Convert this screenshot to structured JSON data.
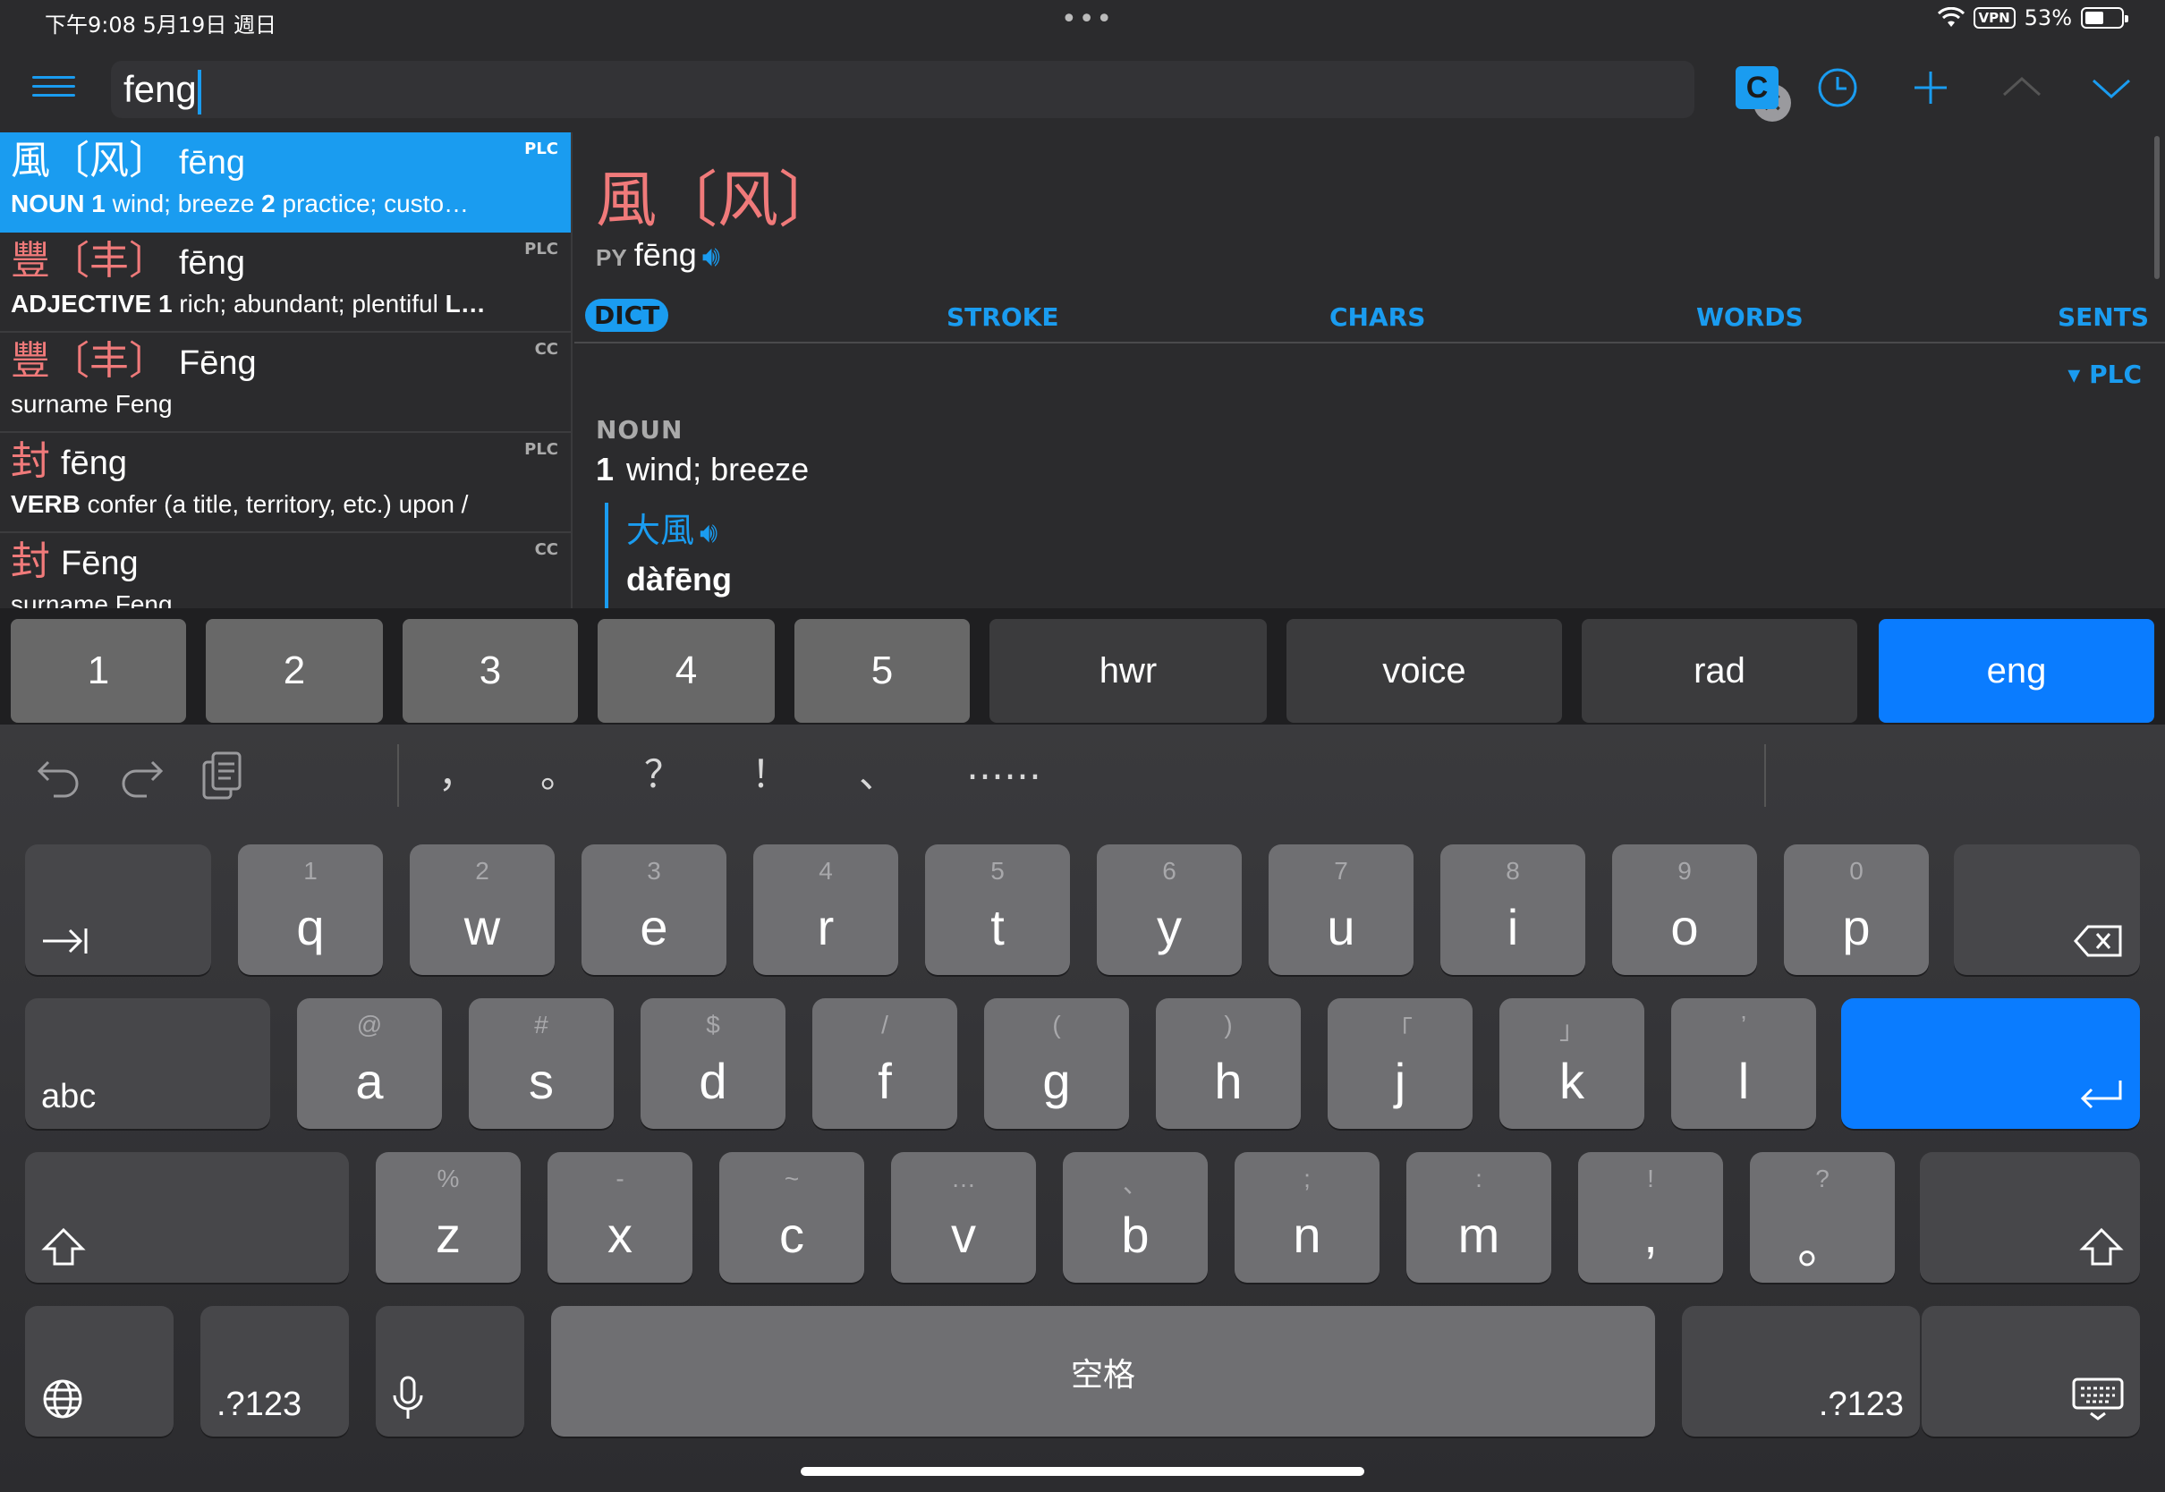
{
  "status": {
    "time": "下午9:08   5月19日 週日",
    "dots": "•••",
    "vpn": "VPN",
    "battery": "53%",
    "battery_level": 0.53
  },
  "toolbar": {
    "search_value": "feng",
    "c_label": "C"
  },
  "results": [
    {
      "hz": "風〔风〕",
      "py": "fēng",
      "src": "PLC",
      "pos": "NOUN",
      "def": "wind; breeze",
      "def2": "practice; custo…",
      "active": true
    },
    {
      "hz": "豐〔丰〕",
      "py": "fēng",
      "src": "PLC",
      "pos": "ADJECTIVE",
      "def": "rich; abundant; plentiful",
      "more": "L…"
    },
    {
      "hz": "豐〔丰〕",
      "py": "Fēng",
      "src": "CC",
      "def": "surname Feng"
    },
    {
      "hz": "封",
      "py": "fēng",
      "src": "PLC",
      "pos": "VERB",
      "def": "confer (a title, territory, etc.) upon /"
    },
    {
      "hz": "封",
      "py": "Fēng",
      "src": "CC",
      "def": "surname Feng"
    }
  ],
  "detail": {
    "headword": "風〔风〕",
    "py_label": "PY",
    "pinyin": "fēng",
    "tabs": [
      "DICT",
      "STROKE",
      "CHARS",
      "WORDS",
      "SENTS"
    ],
    "source_toggle": "▾ PLC",
    "pos": "NOUN",
    "sense_num": "1",
    "sense_def": "wind; breeze",
    "example_hz": "大風",
    "example_py": "dàfēng"
  },
  "candidates": [
    "1",
    "2",
    "3",
    "4",
    "5",
    "hwr",
    "voice",
    "rad",
    "eng"
  ],
  "shortcuts": {
    "punct": [
      "，",
      "。",
      "？",
      "！",
      "、",
      "……"
    ]
  },
  "keyboard": {
    "row1": [
      {
        "h": "1",
        "c": "q"
      },
      {
        "h": "2",
        "c": "w"
      },
      {
        "h": "3",
        "c": "e"
      },
      {
        "h": "4",
        "c": "r"
      },
      {
        "h": "5",
        "c": "t"
      },
      {
        "h": "6",
        "c": "y"
      },
      {
        "h": "7",
        "c": "u"
      },
      {
        "h": "8",
        "c": "i"
      },
      {
        "h": "9",
        "c": "o"
      },
      {
        "h": "0",
        "c": "p"
      }
    ],
    "row2": [
      {
        "h": "@",
        "c": "a"
      },
      {
        "h": "#",
        "c": "s"
      },
      {
        "h": "$",
        "c": "d"
      },
      {
        "h": "/",
        "c": "f"
      },
      {
        "h": "(",
        "c": "g"
      },
      {
        "h": ")",
        "c": "h"
      },
      {
        "h": "「",
        "c": "j"
      },
      {
        "h": "」",
        "c": "k"
      },
      {
        "h": "’",
        "c": "l"
      }
    ],
    "row3": [
      {
        "h": "%",
        "c": "z"
      },
      {
        "h": "-",
        "c": "x"
      },
      {
        "h": "~",
        "c": "c"
      },
      {
        "h": "…",
        "c": "v"
      },
      {
        "h": "、",
        "c": "b"
      },
      {
        "h": ";",
        "c": "n"
      },
      {
        "h": ":",
        "c": "m"
      },
      {
        "h": "!",
        "c": ","
      },
      {
        "h": "?",
        "c": "。"
      }
    ],
    "abc_label": "abc",
    "numbers_label": ".?123",
    "space_label": "空格"
  }
}
